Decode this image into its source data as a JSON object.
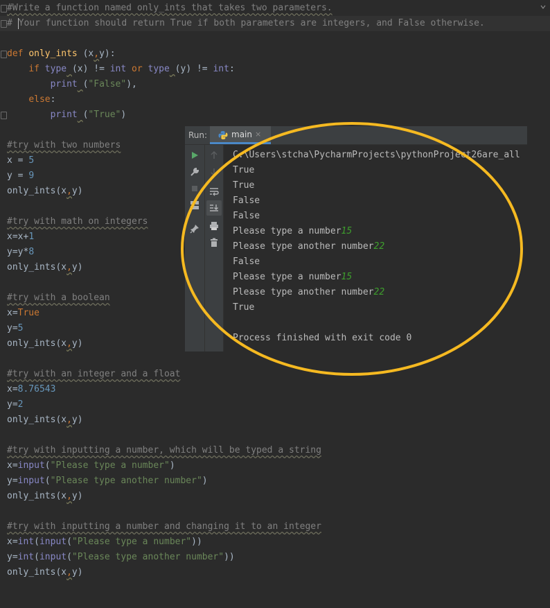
{
  "editor": {
    "lines": [
      {
        "segments": [
          {
            "t": "#Write a function named only_ints that takes two parameters.",
            "c": "cm"
          }
        ]
      },
      {
        "segments": [
          {
            "t": "# ",
            "c": "cm-plain"
          },
          {
            "t": "|",
            "c": "caret"
          },
          {
            "t": "Your function should return True if both parameters are integers, and False otherwise.",
            "c": "cm-plain"
          }
        ]
      },
      {
        "segments": []
      },
      {
        "segments": [
          {
            "t": "def ",
            "c": "kw"
          },
          {
            "t": "only_ints",
            "c": "fn"
          },
          {
            "t": " (x",
            "c": ""
          },
          {
            "t": ",",
            "c": "kw sq"
          },
          {
            "t": "y):",
            "c": ""
          }
        ]
      },
      {
        "segments": [
          {
            "t": "    ",
            "c": ""
          },
          {
            "t": "if ",
            "c": "kw"
          },
          {
            "t": "type",
            "c": "bi"
          },
          {
            "t": " ",
            "c": "sq"
          },
          {
            "t": "(x) != ",
            "c": ""
          },
          {
            "t": "int ",
            "c": "bi"
          },
          {
            "t": "or ",
            "c": "kw"
          },
          {
            "t": "type",
            "c": "bi"
          },
          {
            "t": " ",
            "c": "sq"
          },
          {
            "t": "(y) != ",
            "c": ""
          },
          {
            "t": "int",
            "c": "bi"
          },
          {
            "t": ":",
            "c": ""
          }
        ]
      },
      {
        "segments": [
          {
            "t": "        ",
            "c": ""
          },
          {
            "t": "print",
            "c": "bi"
          },
          {
            "t": " ",
            "c": "sq"
          },
          {
            "t": "(",
            "c": ""
          },
          {
            "t": "\"False\"",
            "c": "str"
          },
          {
            "t": "),",
            "c": ""
          }
        ]
      },
      {
        "segments": [
          {
            "t": "    ",
            "c": ""
          },
          {
            "t": "else",
            "c": "kw"
          },
          {
            "t": ":",
            "c": ""
          }
        ]
      },
      {
        "segments": [
          {
            "t": "        ",
            "c": ""
          },
          {
            "t": "print",
            "c": "bi"
          },
          {
            "t": " ",
            "c": "sq"
          },
          {
            "t": "(",
            "c": ""
          },
          {
            "t": "\"True\"",
            "c": "str"
          },
          {
            "t": ")",
            "c": ""
          }
        ]
      },
      {
        "segments": []
      },
      {
        "segments": [
          {
            "t": "#try with two numbers",
            "c": "cm"
          }
        ]
      },
      {
        "segments": [
          {
            "t": "x = ",
            "c": ""
          },
          {
            "t": "5",
            "c": "num"
          }
        ]
      },
      {
        "segments": [
          {
            "t": "y = ",
            "c": ""
          },
          {
            "t": "9",
            "c": "num"
          }
        ]
      },
      {
        "segments": [
          {
            "t": "only_ints(x",
            "c": ""
          },
          {
            "t": ",",
            "c": "kw sq"
          },
          {
            "t": "y)",
            "c": ""
          }
        ]
      },
      {
        "segments": []
      },
      {
        "segments": [
          {
            "t": "#try with math on integers",
            "c": "cm"
          }
        ]
      },
      {
        "segments": [
          {
            "t": "x=x+",
            "c": ""
          },
          {
            "t": "1",
            "c": "num"
          }
        ]
      },
      {
        "segments": [
          {
            "t": "y=y*",
            "c": ""
          },
          {
            "t": "8",
            "c": "num"
          }
        ]
      },
      {
        "segments": [
          {
            "t": "only_ints(x",
            "c": ""
          },
          {
            "t": ",",
            "c": "kw sq"
          },
          {
            "t": "y)",
            "c": ""
          }
        ]
      },
      {
        "segments": []
      },
      {
        "segments": [
          {
            "t": "#try with a boolean",
            "c": "cm"
          }
        ]
      },
      {
        "segments": [
          {
            "t": "x=",
            "c": ""
          },
          {
            "t": "True",
            "c": "kw"
          }
        ]
      },
      {
        "segments": [
          {
            "t": "y=",
            "c": ""
          },
          {
            "t": "5",
            "c": "num"
          }
        ]
      },
      {
        "segments": [
          {
            "t": "only_ints(x",
            "c": ""
          },
          {
            "t": ",",
            "c": "kw sq"
          },
          {
            "t": "y)",
            "c": ""
          }
        ]
      },
      {
        "segments": []
      },
      {
        "segments": [
          {
            "t": "#try with an integer and a float",
            "c": "cm"
          }
        ]
      },
      {
        "segments": [
          {
            "t": "x=",
            "c": ""
          },
          {
            "t": "8.76543",
            "c": "num"
          }
        ]
      },
      {
        "segments": [
          {
            "t": "y=",
            "c": ""
          },
          {
            "t": "2",
            "c": "num"
          }
        ]
      },
      {
        "segments": [
          {
            "t": "only_ints(x",
            "c": ""
          },
          {
            "t": ",",
            "c": "kw sq"
          },
          {
            "t": "y)",
            "c": ""
          }
        ]
      },
      {
        "segments": []
      },
      {
        "segments": [
          {
            "t": "#try with inputting a number, which will be typed a string",
            "c": "cm"
          }
        ]
      },
      {
        "segments": [
          {
            "t": "x=",
            "c": ""
          },
          {
            "t": "input",
            "c": "bi"
          },
          {
            "t": "(",
            "c": ""
          },
          {
            "t": "\"Please type a number\"",
            "c": "str"
          },
          {
            "t": ")",
            "c": ""
          }
        ]
      },
      {
        "segments": [
          {
            "t": "y=",
            "c": ""
          },
          {
            "t": "input",
            "c": "bi"
          },
          {
            "t": "(",
            "c": ""
          },
          {
            "t": "\"Please type another number\"",
            "c": "str"
          },
          {
            "t": ")",
            "c": ""
          }
        ]
      },
      {
        "segments": [
          {
            "t": "only_ints(x",
            "c": ""
          },
          {
            "t": ",",
            "c": "kw sq"
          },
          {
            "t": "y)",
            "c": ""
          }
        ]
      },
      {
        "segments": []
      },
      {
        "segments": [
          {
            "t": "#try with inputting a number and changing it to an integer",
            "c": "cm"
          }
        ]
      },
      {
        "segments": [
          {
            "t": "x=",
            "c": ""
          },
          {
            "t": "int",
            "c": "bi"
          },
          {
            "t": "(",
            "c": ""
          },
          {
            "t": "input",
            "c": "bi"
          },
          {
            "t": "(",
            "c": ""
          },
          {
            "t": "\"Please type a number\"",
            "c": "str"
          },
          {
            "t": "))",
            "c": ""
          }
        ]
      },
      {
        "segments": [
          {
            "t": "y=",
            "c": ""
          },
          {
            "t": "int",
            "c": "bi"
          },
          {
            "t": "(",
            "c": ""
          },
          {
            "t": "input",
            "c": "bi"
          },
          {
            "t": "(",
            "c": ""
          },
          {
            "t": "\"Please type another number\"",
            "c": "str"
          },
          {
            "t": "))",
            "c": ""
          }
        ]
      },
      {
        "segments": [
          {
            "t": "only_ints(x",
            "c": ""
          },
          {
            "t": ",",
            "c": "kw sq"
          },
          {
            "t": "y)",
            "c": ""
          }
        ]
      }
    ]
  },
  "run_panel": {
    "label": "Run:",
    "tab_label": "main",
    "tab_close": "×",
    "console_lines": [
      {
        "text": "C:\\Users\\stcha\\PycharmProjects\\pythonProject26are_all",
        "input": ""
      },
      {
        "text": "True",
        "input": ""
      },
      {
        "text": "True",
        "input": ""
      },
      {
        "text": "False",
        "input": ""
      },
      {
        "text": "False",
        "input": ""
      },
      {
        "text": "Please type a number",
        "input": "15"
      },
      {
        "text": "Please type another number",
        "input": "22"
      },
      {
        "text": "False",
        "input": ""
      },
      {
        "text": "Please type a number",
        "input": "15"
      },
      {
        "text": "Please type another number",
        "input": "22"
      },
      {
        "text": "True",
        "input": ""
      },
      {
        "text": "",
        "input": ""
      },
      {
        "text": "Process finished with exit code 0",
        "input": ""
      }
    ]
  },
  "colors": {
    "background": "#2b2b2b",
    "keyword": "#cc7832",
    "function": "#ffc66d",
    "string": "#6a8759",
    "number": "#6897bb",
    "comment": "#808080",
    "input_echo": "#3e9f2d",
    "annotation": "#f5b921"
  }
}
